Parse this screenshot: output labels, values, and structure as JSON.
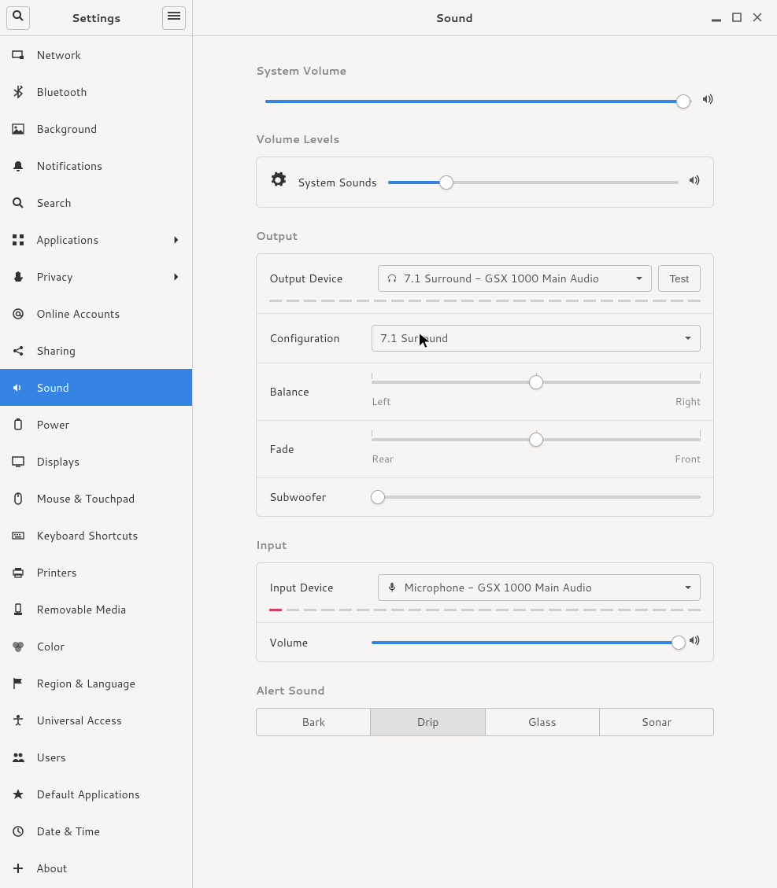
{
  "app_title": "Settings",
  "page_title": "Sound",
  "sidebar": {
    "items": [
      {
        "label": "Network",
        "icon": "network"
      },
      {
        "label": "Bluetooth",
        "icon": "bluetooth"
      },
      {
        "label": "Background",
        "icon": "background"
      },
      {
        "label": "Notifications",
        "icon": "bell"
      },
      {
        "label": "Search",
        "icon": "search"
      },
      {
        "label": "Applications",
        "icon": "apps",
        "chevron": true
      },
      {
        "label": "Privacy",
        "icon": "hand",
        "chevron": true
      },
      {
        "label": "Online Accounts",
        "icon": "at"
      },
      {
        "label": "Sharing",
        "icon": "share"
      },
      {
        "label": "Sound",
        "icon": "sound",
        "active": true
      },
      {
        "label": "Power",
        "icon": "power"
      },
      {
        "label": "Displays",
        "icon": "displays"
      },
      {
        "label": "Mouse & Touchpad",
        "icon": "mouse"
      },
      {
        "label": "Keyboard Shortcuts",
        "icon": "keyboard"
      },
      {
        "label": "Printers",
        "icon": "printer"
      },
      {
        "label": "Removable Media",
        "icon": "media"
      },
      {
        "label": "Color",
        "icon": "color"
      },
      {
        "label": "Region & Language",
        "icon": "flag"
      },
      {
        "label": "Universal Access",
        "icon": "access"
      },
      {
        "label": "Users",
        "icon": "users"
      },
      {
        "label": "Default Applications",
        "icon": "star"
      },
      {
        "label": "Date & Time",
        "icon": "clock"
      },
      {
        "label": "About",
        "icon": "plus"
      }
    ]
  },
  "sections": {
    "system_volume": {
      "title": "System Volume",
      "value_pct": 98
    },
    "volume_levels": {
      "title": "Volume Levels",
      "items": [
        {
          "label": "System Sounds",
          "value_pct": 20
        }
      ]
    },
    "output": {
      "title": "Output",
      "device_label": "Output Device",
      "device_value": "7.1 Surround - GSX 1000 Main Audio",
      "test_label": "Test",
      "config_label": "Configuration",
      "config_value": "7.1 Surround",
      "balance_label": "Balance",
      "balance_left": "Left",
      "balance_right": "Right",
      "balance_pct": 50,
      "fade_label": "Fade",
      "fade_rear": "Rear",
      "fade_front": "Front",
      "fade_pct": 50,
      "subwoofer_label": "Subwoofer",
      "subwoofer_pct": 2
    },
    "input": {
      "title": "Input",
      "device_label": "Input Device",
      "device_value": "Microphone - GSX 1000 Main Audio",
      "volume_label": "Volume",
      "volume_pct": 100,
      "level_active": 1,
      "level_total": 25
    },
    "alert": {
      "title": "Alert Sound",
      "options": [
        "Bark",
        "Drip",
        "Glass",
        "Sonar"
      ],
      "selected": "Drip"
    }
  }
}
